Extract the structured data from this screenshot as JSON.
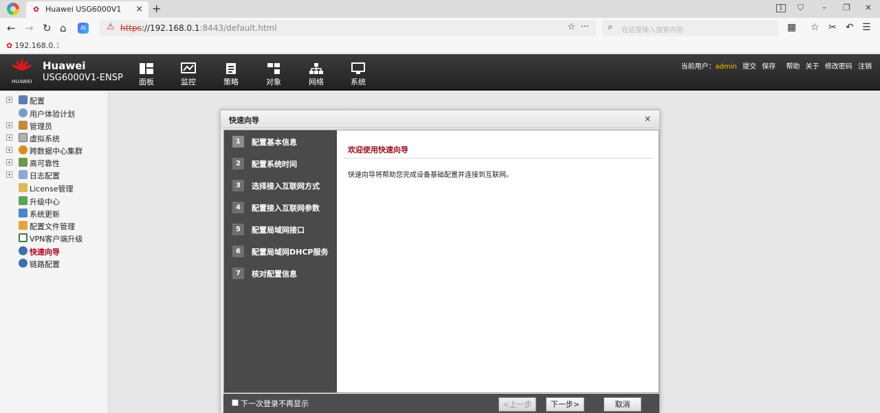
{
  "browser": {
    "tab_title": "Huawei USG6000V1",
    "new_tab": "+",
    "url_scheme": "https",
    "url_host": "://192.168.0.1",
    "url_port": ":8443",
    "url_path": "/default.html",
    "search_placeholder": "在这里输入搜索内容",
    "bookmark_host": "192.168.0.",
    "bookmark_host_dim": "1"
  },
  "header": {
    "brand": "Huawei",
    "model": "USG6000V1-ENSP",
    "logo_word": "HUAWEI",
    "nav": [
      {
        "label": "面板",
        "icon": "dashboard-icon"
      },
      {
        "label": "监控",
        "icon": "monitor-chart-icon"
      },
      {
        "label": "策略",
        "icon": "policy-doc-icon"
      },
      {
        "label": "对象",
        "icon": "object-icon"
      },
      {
        "label": "网络",
        "icon": "network-topology-icon"
      },
      {
        "label": "系统",
        "icon": "system-computer-icon"
      }
    ],
    "current_user_label": "当前用户：",
    "username": "admin",
    "links": [
      "提交",
      "保存",
      "帮助",
      "关于",
      "修改密码",
      "注销"
    ]
  },
  "sidebar": {
    "items": [
      {
        "label": "配置",
        "expandable": true,
        "icon": "config-icon"
      },
      {
        "label": "用户体验计划",
        "expandable": false,
        "icon": "user-experience-icon"
      },
      {
        "label": "管理员",
        "expandable": true,
        "icon": "admin-icon"
      },
      {
        "label": "虚拟系统",
        "expandable": true,
        "icon": "virtual-system-icon"
      },
      {
        "label": "跨数据中心集群",
        "expandable": true,
        "icon": "cluster-icon"
      },
      {
        "label": "高可靠性",
        "expandable": true,
        "icon": "high-availability-icon"
      },
      {
        "label": "日志配置",
        "expandable": true,
        "icon": "log-config-icon"
      },
      {
        "label": "License管理",
        "expandable": false,
        "icon": "license-icon"
      },
      {
        "label": "升级中心",
        "expandable": false,
        "icon": "upgrade-icon"
      },
      {
        "label": "系统更新",
        "expandable": false,
        "icon": "system-update-icon"
      },
      {
        "label": "配置文件管理",
        "expandable": false,
        "icon": "config-file-icon"
      },
      {
        "label": "VPN客户端升级",
        "expandable": false,
        "icon": "vpn-upgrade-icon"
      },
      {
        "label": "快速向导",
        "expandable": false,
        "icon": "quick-wizard-icon",
        "active": true
      },
      {
        "label": "链路配置",
        "expandable": false,
        "icon": "link-config-icon"
      }
    ]
  },
  "dialog": {
    "title": "快速向导",
    "close": "×",
    "steps": [
      {
        "num": "1",
        "label": "配置基本信息"
      },
      {
        "num": "2",
        "label": "配置系统时间"
      },
      {
        "num": "3",
        "label": "选择接入互联网方式"
      },
      {
        "num": "4",
        "label": "配置接入互联网参数"
      },
      {
        "num": "5",
        "label": "配置局域网接口"
      },
      {
        "num": "6",
        "label": "配置局域网DHCP服务"
      },
      {
        "num": "7",
        "label": "核对配置信息"
      }
    ],
    "welcome_title": "欢迎使用快速向导",
    "welcome_text": "快速向导将帮助您完成设备基础配置并连接到互联网。",
    "dont_show_label": "下一次登录不再显示",
    "prev_button": "<上一步",
    "next_button": "下一步>",
    "cancel_button": "取消"
  },
  "colors": {
    "accent_red": "#9c0b19",
    "header_bg": "#2b2b2b",
    "wizard_steps_bg": "#4a4a4a",
    "username": "#f5c400"
  }
}
